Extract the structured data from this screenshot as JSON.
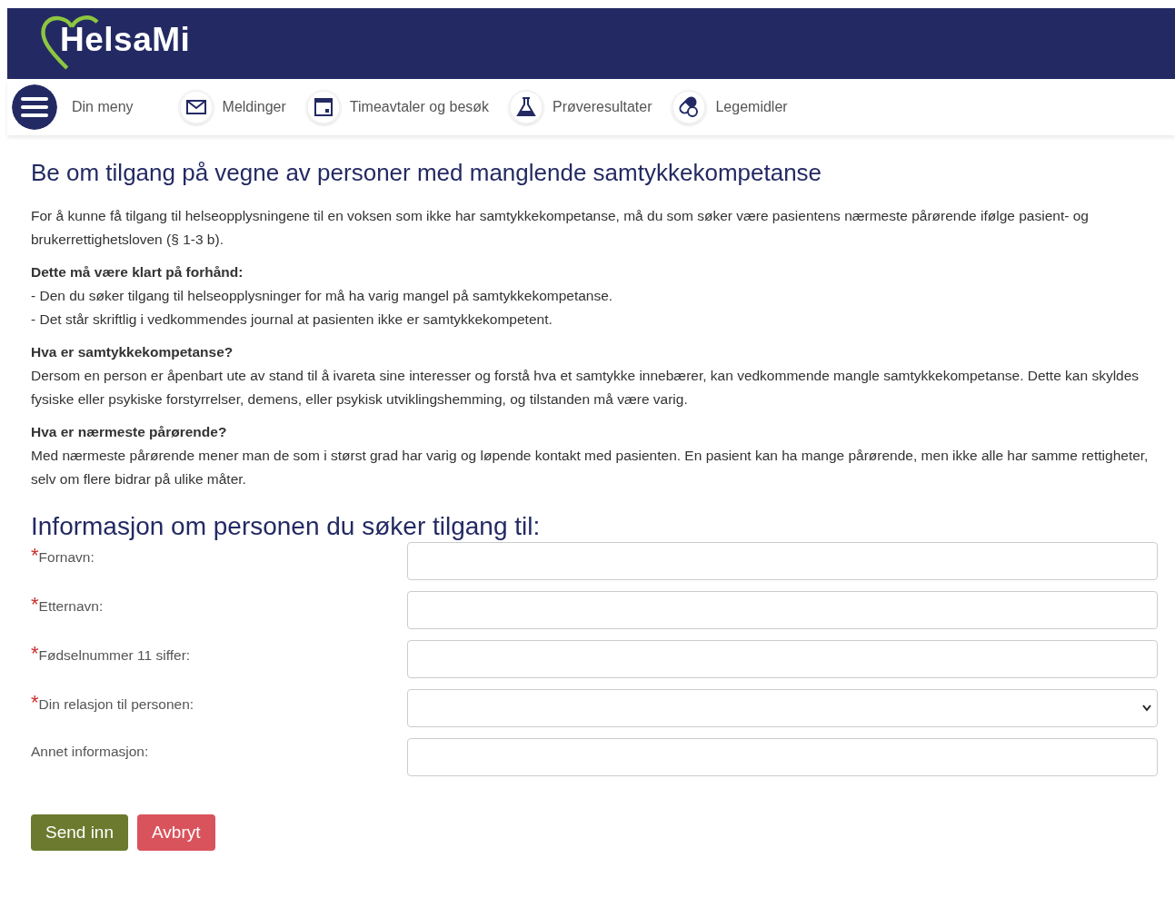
{
  "header": {
    "logo": "HelsaMi"
  },
  "nav": [
    {
      "kind": "menu",
      "label": "Din meny"
    },
    {
      "kind": "mail",
      "label": "Meldinger"
    },
    {
      "kind": "calendar",
      "label": "Timeavtaler og besøk"
    },
    {
      "kind": "flask",
      "label": "Prøveresultater"
    },
    {
      "kind": "pill",
      "label": "Legemidler"
    }
  ],
  "title": "Be om tilgang på vegne av personer med manglende samtykkekompetanse",
  "intro": "For å kunne få tilgang til helseopplysningene til en voksen som ikke har samtykkekompetanse, må du som søker være pasientens nærmeste pårørende ifølge pasient- og brukerrettighetsloven (§ 1-3 b).",
  "sections": [
    {
      "heading": "Dette må være klart på forhånd:",
      "lines": [
        "- Den du søker tilgang til helseopplysninger for må ha varig mangel på samtykkekompetanse.",
        "- Det står skriftlig i vedkommendes journal at pasienten ikke er samtykkekompetent."
      ]
    },
    {
      "heading": "Hva er samtykkekompetanse?",
      "lines": [
        "Dersom en person er åpenbart ute av stand til å ivareta sine interesser og forstå hva et samtykke innebærer, kan vedkommende mangle samtykkekompetanse. Dette kan skyldes fysiske eller psykiske forstyrrelser, demens, eller psykisk utviklingshemming, og tilstanden må være varig."
      ]
    },
    {
      "heading": "Hva er nærmeste pårørende?",
      "lines": [
        "Med nærmeste pårørende mener man de som i størst grad har varig og løpende kontakt med pasienten. En pasient kan ha mange pårørende, men ikke alle har samme rettigheter, selv om flere bidrar på ulike måter."
      ]
    }
  ],
  "form": {
    "heading": "Informasjon om personen du søker tilgang til:",
    "fields": [
      {
        "kind": "text",
        "label": "Fornavn:",
        "required": true,
        "required_mark": "*"
      },
      {
        "kind": "text",
        "label": "Etternavn:",
        "required": true,
        "required_mark": "*"
      },
      {
        "kind": "text",
        "label": "Fødselnummer 11 siffer:",
        "required": true,
        "required_mark": "*"
      },
      {
        "kind": "select",
        "label": "Din relasjon til personen:",
        "required": true,
        "required_mark": "*"
      },
      {
        "kind": "text",
        "label": "Annet informasjon:",
        "required": false
      }
    ],
    "buttons": [
      {
        "kind": "submit",
        "label": "Send inn"
      },
      {
        "kind": "cancel",
        "label": "Avbryt"
      }
    ]
  }
}
